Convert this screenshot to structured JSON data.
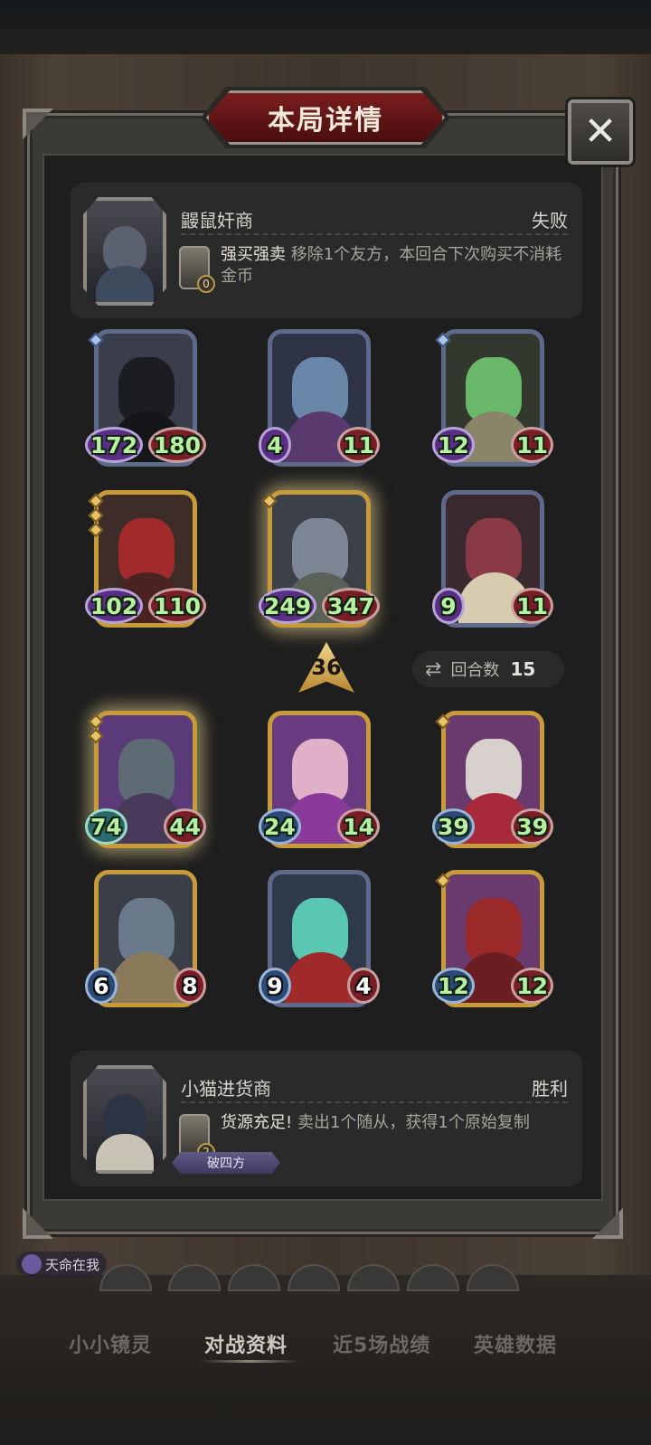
{
  "dialog": {
    "title": "本局详情",
    "close_icon": "close-icon"
  },
  "opponent": {
    "name": "鼹鼠奸商",
    "result": "失败",
    "skill_cost": "0",
    "skill_name": "强买强卖",
    "skill_desc": "移除1个友方，本回合下次购买不消耗金币"
  },
  "opponent_board": [
    {
      "atk": "172",
      "hp": "180"
    },
    {
      "atk": "4",
      "hp": "11"
    },
    {
      "atk": "12",
      "hp": "11"
    },
    {
      "atk": "102",
      "hp": "110"
    },
    {
      "atk": "249",
      "hp": "347"
    },
    {
      "atk": "9",
      "hp": "11"
    }
  ],
  "level": "36",
  "rounds": {
    "label": "回合数",
    "value": "15"
  },
  "player_board": [
    {
      "atk": "74",
      "hp": "44"
    },
    {
      "atk": "24",
      "hp": "14"
    },
    {
      "atk": "39",
      "hp": "39"
    },
    {
      "atk": "6",
      "hp": "8"
    },
    {
      "atk": "9",
      "hp": "4"
    },
    {
      "atk": "12",
      "hp": "12"
    }
  ],
  "player": {
    "name": "小猫进货商",
    "result": "胜利",
    "skill_cost": "2",
    "skill_name": "货源充足!",
    "skill_desc": "卖出1个随从，获得1个原始复制",
    "tag": "破四方"
  },
  "fate_badge": "天命在我",
  "tabs": [
    "小小镜灵",
    "对战资料",
    "近5场战绩",
    "英雄数据"
  ],
  "active_tab": "对战资料",
  "colors": {
    "title_banner": "#7a1d1d",
    "attack_orb": "#5a2e86",
    "health_orb": "#7a1d24",
    "stat_text": "#b6f0a0",
    "gold_frame": "#c79a3a"
  }
}
